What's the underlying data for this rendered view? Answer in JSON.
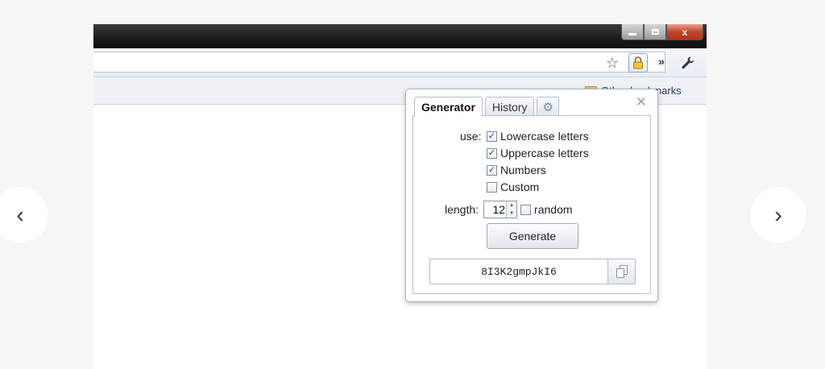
{
  "window": {
    "minimize_glyph": "",
    "close_glyph": "x"
  },
  "toolbar": {
    "star_icon": "☆",
    "lock_icon": "🔒",
    "overflow_icon": "»",
    "wrench_icon": "🔧"
  },
  "bookmarks_bar": {
    "label": "Other bookmarks"
  },
  "popup": {
    "close_glyph": "✕",
    "tabs": [
      {
        "label": "Generator",
        "active": true
      },
      {
        "label": "History",
        "active": false
      },
      {
        "label": "⚙",
        "icon": "gear-icon",
        "active": false
      }
    ],
    "use_label": "use:",
    "options": [
      {
        "label": "Lowercase letters",
        "checked": true
      },
      {
        "label": "Uppercase letters",
        "checked": true
      },
      {
        "label": "Numbers",
        "checked": true
      },
      {
        "label": "Custom",
        "checked": false
      }
    ],
    "length_label": "length:",
    "length_value": "12",
    "random_label": "random",
    "random_checked": false,
    "generate_label": "Generate",
    "password": "8I3K2gmpJkI6"
  },
  "carousel": {
    "prev_glyph": "‹",
    "next_glyph": "›"
  }
}
